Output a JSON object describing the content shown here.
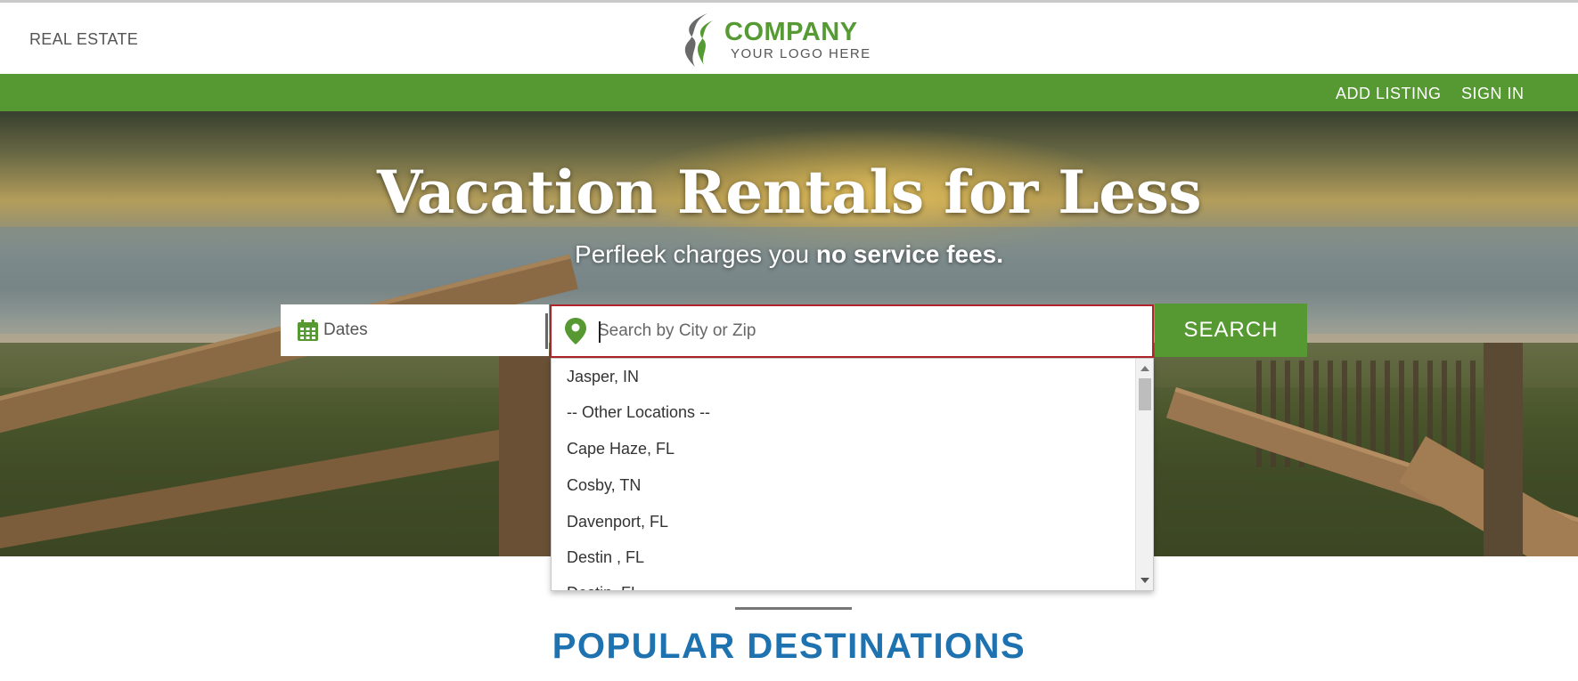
{
  "header": {
    "left_label": "REAL ESTATE",
    "logo": {
      "name": "COMPANY",
      "tagline": "YOUR LOGO HERE"
    }
  },
  "nav": {
    "add_listing": "ADD LISTING",
    "sign_in": "SIGN IN"
  },
  "hero": {
    "title": "Vacation Rentals for Less",
    "subtitle_prefix": "Perfleek charges you ",
    "subtitle_bold": "no service fees."
  },
  "search": {
    "dates_label": "Dates",
    "placeholder": "Search by City or Zip",
    "button_label": "SEARCH"
  },
  "dropdown": {
    "items": [
      "Jasper, IN",
      "-- Other Locations --",
      "Cape Haze, FL",
      "Cosby, TN",
      "Davenport, FL",
      "Destin , FL",
      "Destin, FL"
    ]
  },
  "section": {
    "popular_title": "POPULAR DESTINATIONS"
  },
  "colors": {
    "brand_green": "#569932",
    "accent_blue": "#1e72b0",
    "focus_red": "#b0232a"
  },
  "icons": {
    "calendar": "calendar-icon",
    "pin": "map-pin-icon",
    "logo": "logo-mark-icon"
  }
}
